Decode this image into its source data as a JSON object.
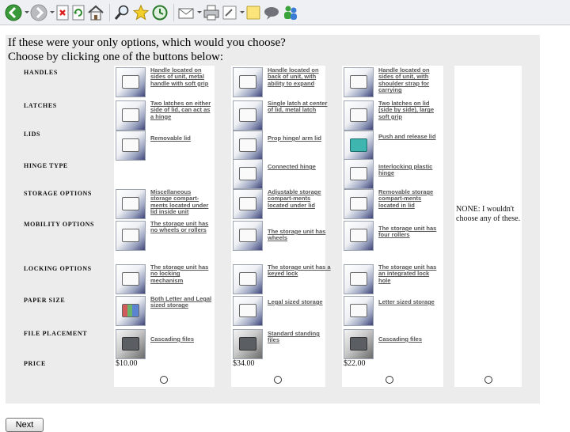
{
  "toolbar": {
    "items": [
      "back-icon",
      "forward-icon",
      "stop-icon",
      "refresh-icon",
      "home-icon",
      "search-icon",
      "favorites-icon",
      "history-icon",
      "mail-icon",
      "print-icon",
      "edit-icon",
      "note-icon",
      "discuss-icon",
      "messenger-icon"
    ]
  },
  "survey": {
    "question_line1": "If these were your only options, which would you choose?",
    "question_line2": "Choose by clicking one of the buttons below:",
    "row_labels": [
      "HANDLES",
      "LATCHES",
      "LIDS",
      "HINGE TYPE",
      "STORAGE OPTIONS",
      "MOBILITY OPTIONS",
      "LOCKING OPTIONS",
      "PAPER SIZE",
      "FILE PLACEMENT",
      "PRICE"
    ],
    "options": [
      {
        "handles": "Handle located on sides of unit, metal handle with soft grip",
        "latches": "Two latches on either side of lid, can act as a hinge",
        "lids": "Removable lid",
        "hinge": "",
        "storage": "Miscellaneous storage compart-ments located under lid inside unit",
        "mobility": "The storage unit has no wheels or rollers",
        "locking": "The storage unit has no locking mechanism",
        "paper": "Both Letter and Legal sized storage",
        "file": "Cascading files",
        "price": "$10.00"
      },
      {
        "handles": "Handle located on back of unit, with ability to expand",
        "latches": "Single latch at center of lid, metal latch",
        "lids": "Prop hinge/ arm lid",
        "hinge": "Connected hinge",
        "storage": "Adjustable storage compart-ments located under lid",
        "mobility": "The storage unit has wheels",
        "locking": "The storage unit has a keyed lock",
        "paper": "Legal sized storage",
        "file": "Standard standing files",
        "price": "$34.00"
      },
      {
        "handles": "Handle located on sides of unit, with shoulder strap for carrying",
        "latches": "Two latches on lid (side by side), large soft grip",
        "lids": "Push and release lid",
        "hinge": "Interlocking plastic hinge",
        "storage": "Removable storage compart-ments located in lid",
        "mobility": "The storage unit has four rollers",
        "locking": "The storage unit has an integrated lock hole",
        "paper": "Letter sized storage",
        "file": "Cascading files",
        "price": "$22.00"
      }
    ],
    "none_option": "NONE: I wouldn't choose any of these.",
    "next_label": "Next"
  }
}
